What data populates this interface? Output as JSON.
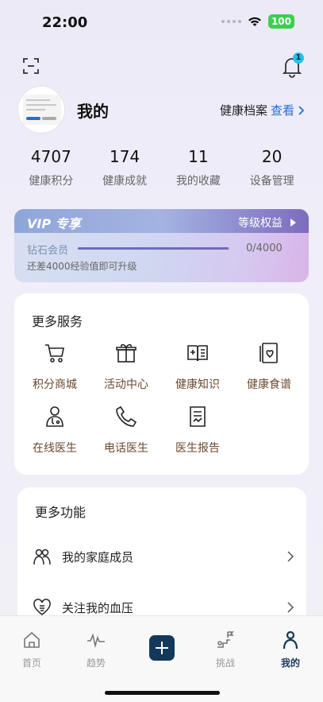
{
  "status_bar": {
    "time": "22:00",
    "battery": "100"
  },
  "header": {
    "notification_count": "1"
  },
  "profile": {
    "name": "我的",
    "health_record_label": "健康档案",
    "health_record_link": "查看"
  },
  "stats": [
    {
      "value": "4707",
      "label": "健康积分"
    },
    {
      "value": "174",
      "label": "健康成就"
    },
    {
      "value": "11",
      "label": "我的收藏"
    },
    {
      "value": "20",
      "label": "设备管理"
    }
  ],
  "vip": {
    "tag": "VIP 专享",
    "rights_label": "等级权益",
    "level": "钻石会员",
    "progress_text": "0/4000",
    "progress_fraction": 0.99,
    "hint": "还差4000经验值即可升级"
  },
  "services": {
    "title": "更多服务",
    "items": [
      {
        "label": "积分商城",
        "icon": "cart-icon"
      },
      {
        "label": "活动中心",
        "icon": "gift-icon"
      },
      {
        "label": "健康知识",
        "icon": "health-book-icon"
      },
      {
        "label": "健康食谱",
        "icon": "recipe-icon"
      },
      {
        "label": "在线医生",
        "icon": "doctor-icon"
      },
      {
        "label": "电话医生",
        "icon": "phone-icon"
      },
      {
        "label": "医生报告",
        "icon": "report-icon"
      }
    ]
  },
  "features": {
    "title": "更多功能",
    "items": [
      {
        "label": "我的家庭成员",
        "icon": "family-icon"
      },
      {
        "label": "关注我的血压",
        "icon": "heart-icon"
      }
    ]
  },
  "tabbar": {
    "items": [
      {
        "label": "首页",
        "icon": "home-icon"
      },
      {
        "label": "趋势",
        "icon": "trend-icon"
      },
      {
        "label": "",
        "icon": "add-icon"
      },
      {
        "label": "挑战",
        "icon": "challenge-icon"
      },
      {
        "label": "我的",
        "icon": "person-icon"
      }
    ],
    "active_index": 4
  },
  "colors": {
    "accent": "#1c6fd1",
    "tab_active": "#13385a",
    "vip_bar": "#6f69c4"
  }
}
